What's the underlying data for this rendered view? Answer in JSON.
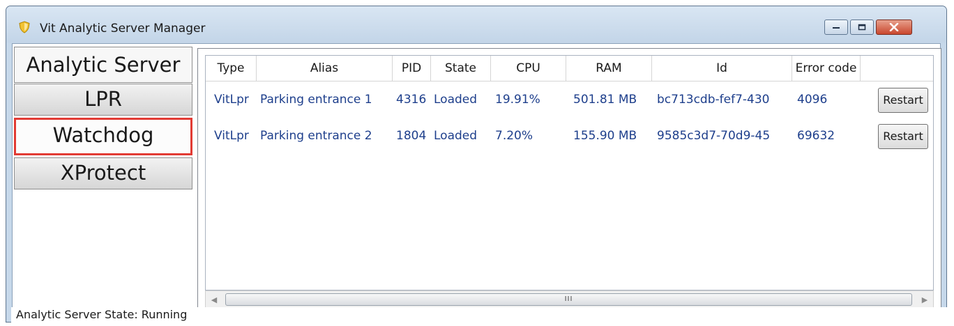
{
  "window": {
    "title": "Vit Analytic Server Manager",
    "icons": {
      "app": "shield-icon",
      "minimize": "minimize-icon",
      "maximize": "maximize-icon",
      "close": "close-icon"
    }
  },
  "sidebar": {
    "items": [
      {
        "label": "Analytic Server",
        "state": "selected"
      },
      {
        "label": "LPR",
        "state": "normal"
      },
      {
        "label": "Watchdog",
        "state": "highlighted"
      },
      {
        "label": "XProtect",
        "state": "normal"
      }
    ],
    "highlight_color": "#e23b34"
  },
  "table": {
    "columns": [
      "Type",
      "Alias",
      "PID",
      "State",
      "CPU",
      "RAM",
      "Id",
      "Error code"
    ],
    "rows": [
      {
        "type": "VitLpr",
        "alias": "Parking entrance 1",
        "pid": "4316",
        "state": "Loaded",
        "cpu": "19.91%",
        "ram": "501.81 MB",
        "id": "bc713cdb-fef7-430",
        "error_code": "4096",
        "action": "Restart"
      },
      {
        "type": "VitLpr",
        "alias": "Parking entrance 2",
        "pid": "1804",
        "state": "Loaded",
        "cpu": "7.20%",
        "ram": "155.90 MB",
        "id": "9585c3d7-70d9-45",
        "error_code": "69632",
        "action": "Restart"
      }
    ],
    "cell_text_color": "#1e3f8c",
    "scrollbar": {
      "grip": "III"
    }
  },
  "status": {
    "text": "Analytic Server State: Running"
  }
}
